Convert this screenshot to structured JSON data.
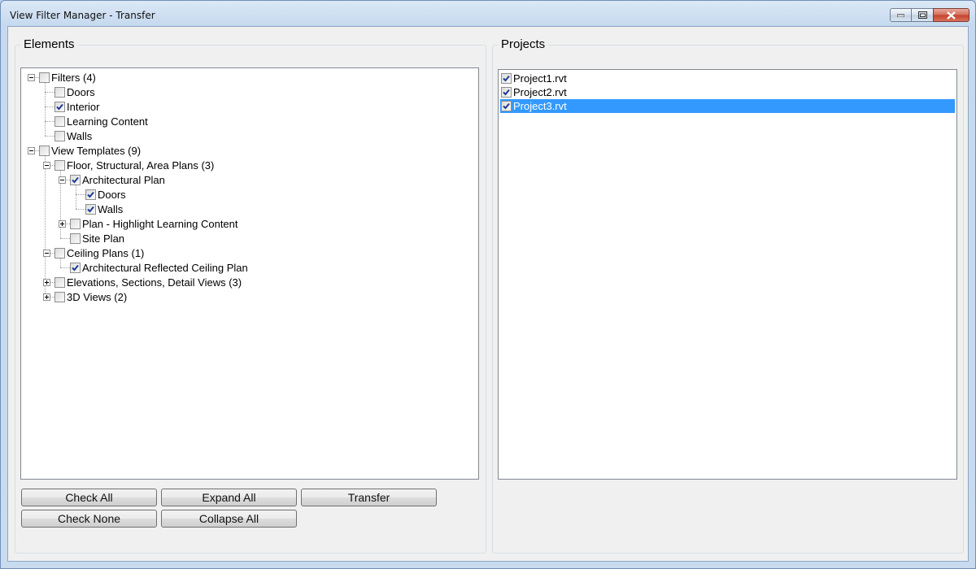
{
  "window": {
    "title": "View Filter Manager  - Transfer"
  },
  "elements": {
    "label": "Elements",
    "tree": [
      {
        "label": "Filters (4)",
        "checked": false,
        "level": 0,
        "expander": "-"
      },
      {
        "label": "Doors",
        "checked": false,
        "level": 1
      },
      {
        "label": "Interior",
        "checked": true,
        "level": 1
      },
      {
        "label": "Learning Content",
        "checked": false,
        "level": 1
      },
      {
        "label": "Walls",
        "checked": false,
        "level": 1
      },
      {
        "label": "View Templates (9)",
        "checked": false,
        "level": 0,
        "expander": "-"
      },
      {
        "label": "Floor, Structural, Area Plans (3)",
        "checked": false,
        "level": 1,
        "expander": "-"
      },
      {
        "label": "Architectural Plan",
        "checked": true,
        "level": 2,
        "expander": "-"
      },
      {
        "label": "Doors",
        "checked": true,
        "level": 3
      },
      {
        "label": "Walls",
        "checked": true,
        "level": 3
      },
      {
        "label": "Plan - Highlight Learning Content",
        "checked": false,
        "level": 2,
        "expander": "+"
      },
      {
        "label": "Site Plan",
        "checked": false,
        "level": 2
      },
      {
        "label": "Ceiling Plans (1)",
        "checked": false,
        "level": 1,
        "expander": "-"
      },
      {
        "label": "Architectural Reflected Ceiling Plan",
        "checked": true,
        "level": 2
      },
      {
        "label": "Elevations, Sections, Detail Views (3)",
        "checked": false,
        "level": 1,
        "expander": "+"
      },
      {
        "label": "3D Views (2)",
        "checked": false,
        "level": 1,
        "expander": "+"
      }
    ]
  },
  "buttons": {
    "check_all": "Check All",
    "expand_all": "Expand All",
    "transfer": "Transfer",
    "check_none": "Check None",
    "collapse_all": "Collapse All"
  },
  "projects": {
    "label": "Projects",
    "items": [
      {
        "label": "Project1.rvt",
        "checked": true,
        "selected": false
      },
      {
        "label": "Project2.rvt",
        "checked": true,
        "selected": false
      },
      {
        "label": "Project3.rvt",
        "checked": true,
        "selected": true
      }
    ]
  }
}
